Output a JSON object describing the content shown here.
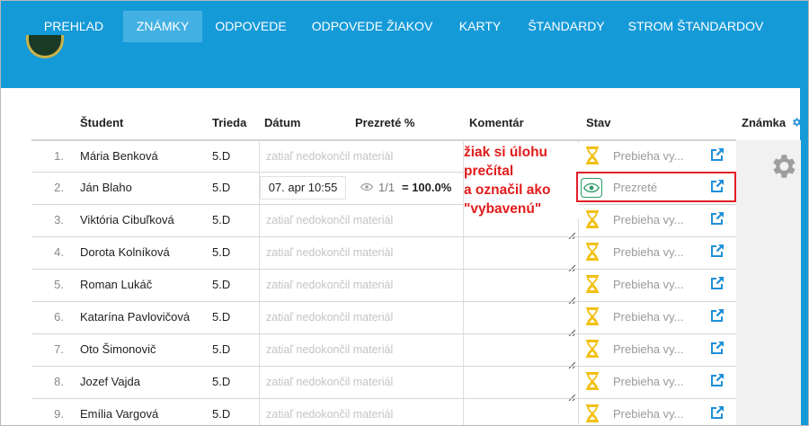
{
  "nav": {
    "items": [
      "PREHĽAD",
      "ZNÁMKY",
      "ODPOVEDE",
      "ODPOVEDE ŽIAKOV",
      "KARTY",
      "ŠTANDARDY",
      "STROM ŠTANDARDOV"
    ],
    "active_index": 1
  },
  "table": {
    "headers": {
      "student": "Študent",
      "class": "Trieda",
      "date": "Dátum",
      "viewed": "Prezreté %",
      "comment": "Komentár",
      "status": "Stav",
      "grade": "Známka"
    },
    "rows": [
      {
        "num": "1.",
        "name": "Mária Benková",
        "class": "5.D",
        "date": "zatiaľ nedokončil materiál",
        "status": "Prebieha vy..."
      },
      {
        "num": "2.",
        "name": "Ján Blaho",
        "class": "5.D",
        "date": "07. apr 10:55",
        "views": "1/1",
        "percent": "= 100.0%",
        "status": "Prezreté"
      },
      {
        "num": "3.",
        "name": "Viktória Cibuľková",
        "class": "5.D",
        "date": "zatiaľ nedokončil materiál",
        "status": "Prebieha vy..."
      },
      {
        "num": "4.",
        "name": "Dorota Kolníková",
        "class": "5.D",
        "date": "zatiaľ nedokončil materiál",
        "status": "Prebieha vy..."
      },
      {
        "num": "5.",
        "name": "Roman Lukáč",
        "class": "5.D",
        "date": "zatiaľ nedokončil materiál",
        "status": "Prebieha vy..."
      },
      {
        "num": "6.",
        "name": "Katarína Pavlovičová",
        "class": "5.D",
        "date": "zatiaľ nedokončil materiál",
        "status": "Prebieha vy..."
      },
      {
        "num": "7.",
        "name": "Oto Šimonovič",
        "class": "5.D",
        "date": "zatiaľ nedokončil materiál",
        "status": "Prebieha vy..."
      },
      {
        "num": "8.",
        "name": "Jozef Vajda",
        "class": "5.D",
        "date": "zatiaľ nedokončil materiál",
        "status": "Prebieha vy..."
      },
      {
        "num": "9.",
        "name": "Emília Vargová",
        "class": "5.D",
        "date": "zatiaľ nedokončil materiál",
        "status": "Prebieha vy..."
      }
    ]
  },
  "annotation": {
    "lines": [
      "žiak si úlohu",
      "prečítal",
      "a označil ako",
      "\"vybavenú\""
    ]
  },
  "icons": {
    "in_progress": "hourglass-icon",
    "viewed": "eye-icon",
    "open": "external-link-icon",
    "settings": "gear-icon"
  },
  "colors": {
    "nav": "#159ad8",
    "nav_active": "#43b0e3",
    "link": "#1e8fd8",
    "hourglass": "#f2c011",
    "eye": "#2c9a64",
    "annotation": "#e21b1b"
  }
}
